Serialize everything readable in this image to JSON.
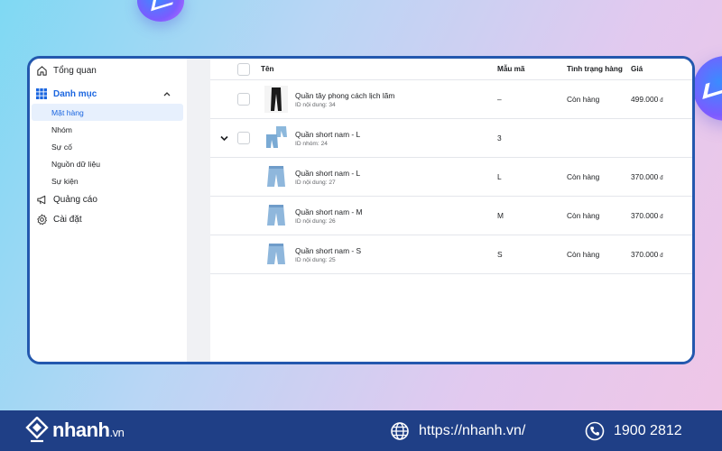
{
  "sidebar": {
    "items": [
      {
        "label": "Tổng quan",
        "icon": "home-icon"
      },
      {
        "label": "Danh mục",
        "icon": "grid-icon",
        "expanded": true
      },
      {
        "label": "Quảng cáo",
        "icon": "megaphone-icon"
      },
      {
        "label": "Cài đặt",
        "icon": "gear-icon"
      }
    ],
    "subitems": [
      {
        "label": "Mặt hàng",
        "active": true
      },
      {
        "label": "Nhóm"
      },
      {
        "label": "Sự cố"
      },
      {
        "label": "Nguồn dữ liệu"
      },
      {
        "label": "Sự kiện"
      }
    ]
  },
  "table": {
    "headers": {
      "name": "Tên",
      "variant": "Mẫu mã",
      "status": "Tình trạng hàng",
      "price": "Giá"
    },
    "rows": [
      {
        "name": "Quần tây phong cách lịch lãm",
        "id_text": "ID nội dung: 34",
        "variant": "–",
        "status": "Còn hàng",
        "price": "499.000",
        "currency": "đ",
        "thumb": "black-trousers"
      },
      {
        "name": "Quần short nam - L",
        "id_text": "ID nhóm: 24",
        "variant": "3",
        "status": "",
        "price": "",
        "currency": "",
        "thumb": "shorts-group",
        "group": true
      },
      {
        "name": "Quần short nam - L",
        "id_text": "ID nội dung: 27",
        "variant": "L",
        "status": "Còn hàng",
        "price": "370.000",
        "currency": "đ",
        "thumb": "denim-shorts"
      },
      {
        "name": "Quần short nam - M",
        "id_text": "ID nội dung: 26",
        "variant": "M",
        "status": "Còn hàng",
        "price": "370.000",
        "currency": "đ",
        "thumb": "denim-shorts"
      },
      {
        "name": "Quần short nam - S",
        "id_text": "ID nội dung: 25",
        "variant": "S",
        "status": "Còn hàng",
        "price": "370.000",
        "currency": "đ",
        "thumb": "denim-shorts"
      }
    ]
  },
  "footer": {
    "brand": "nhanh",
    "brand_domain": ".vn",
    "website": "https://nhanh.vn/",
    "phone": "1900 2812"
  },
  "colors": {
    "frame": "#2358ae",
    "accent": "#1b66e0",
    "footer_bg": "#1f3f86"
  }
}
